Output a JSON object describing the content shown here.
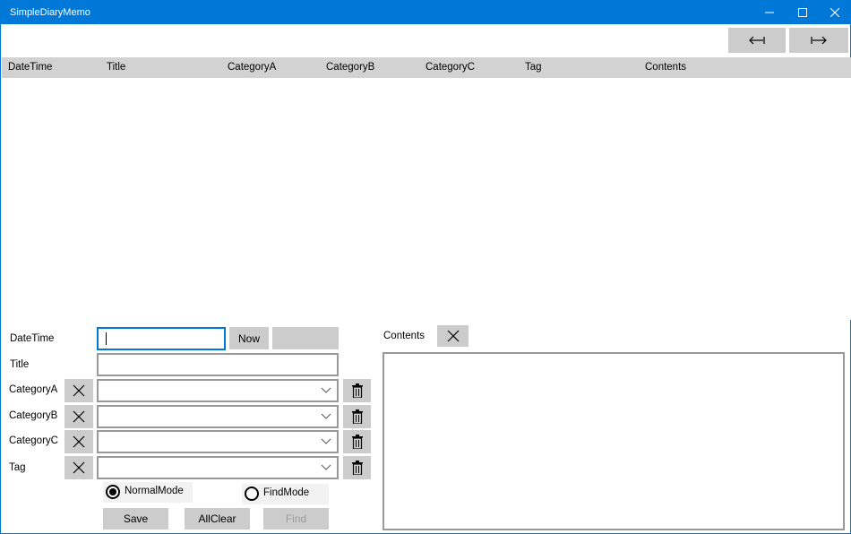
{
  "window": {
    "title": "SimpleDiaryMemo",
    "controls": [
      "minimize-icon",
      "maximize-icon",
      "close-icon"
    ]
  },
  "nav": {
    "prev_icon": "arrow-left-bar-icon",
    "next_icon": "arrow-right-bar-icon"
  },
  "grid": {
    "columns": [
      "DateTime",
      "Title",
      "CategoryA",
      "CategoryB",
      "CategoryC",
      "Tag",
      "Contents"
    ],
    "rows": []
  },
  "form": {
    "datetime_label": "DateTime",
    "datetime_value": "",
    "now_label": "Now",
    "extra_button_label": "",
    "title_label": "Title",
    "title_value": "",
    "categoryA_label": "CategoryA",
    "categoryA_value": "",
    "categoryB_label": "CategoryB",
    "categoryB_value": "",
    "categoryC_label": "CategoryC",
    "categoryC_value": "",
    "tag_label": "Tag",
    "tag_value": "",
    "normal_mode_label": "NormalMode",
    "find_mode_label": "FindMode",
    "selected_mode": "NormalMode",
    "save_label": "Save",
    "allclear_label": "AllClear",
    "find_label": "Find",
    "find_enabled": false
  },
  "contents": {
    "label": "Contents",
    "value": ""
  },
  "colors": {
    "titlebar": "#0078d7",
    "button": "#cccccc",
    "header": "#d2d2d2",
    "focus": "#0078d7"
  }
}
